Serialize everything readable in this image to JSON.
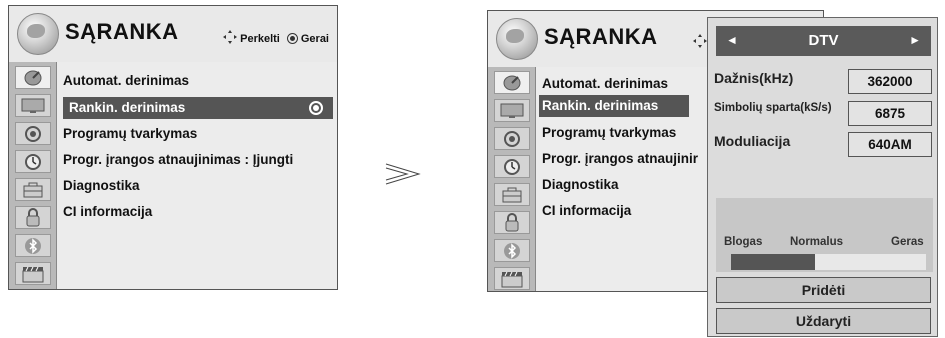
{
  "left_panel": {
    "title": "SĄRANKA",
    "nav_hint_move": "Perkelti",
    "nav_hint_ok": "Gerai",
    "menu_items": [
      "Automat. derinimas",
      "Rankin. derinimas",
      "Programų tvarkymas",
      "Progr. įrangos atnaujinimas : Įjungti",
      "Diagnostika",
      "CI informacija"
    ],
    "selected_index": 1
  },
  "right_panel": {
    "title": "SĄRANKA",
    "menu_items": [
      "Automat. derinimas",
      "Rankin. derinimas",
      "Programų tvarkymas",
      "Progr. įrangos atnaujinir",
      "Diagnostika",
      "CI informacija"
    ]
  },
  "separator_glyph": ">",
  "dialog": {
    "prev_glyph": "◄",
    "mode": "DTV",
    "next_glyph": "►",
    "frequency_label": "Dažnis(kHz)",
    "frequency_value": "362000",
    "symbol_rate_label": "Simbolių sparta(kS/s)",
    "symbol_rate_value": "6875",
    "modulation_label": "Moduliacija",
    "modulation_value": "640AM",
    "signal_labels": [
      "Blogas",
      "Normalus",
      "Geras"
    ],
    "signal_level": 0.43,
    "add_button": "Pridėti",
    "close_button": "Uždaryti"
  },
  "icons": [
    "satellite-dish-icon",
    "tv-screen-icon",
    "speaker-icon",
    "clock-icon",
    "toolbox-icon",
    "padlock-icon",
    "bluetooth-icon",
    "clapperboard-icon"
  ]
}
